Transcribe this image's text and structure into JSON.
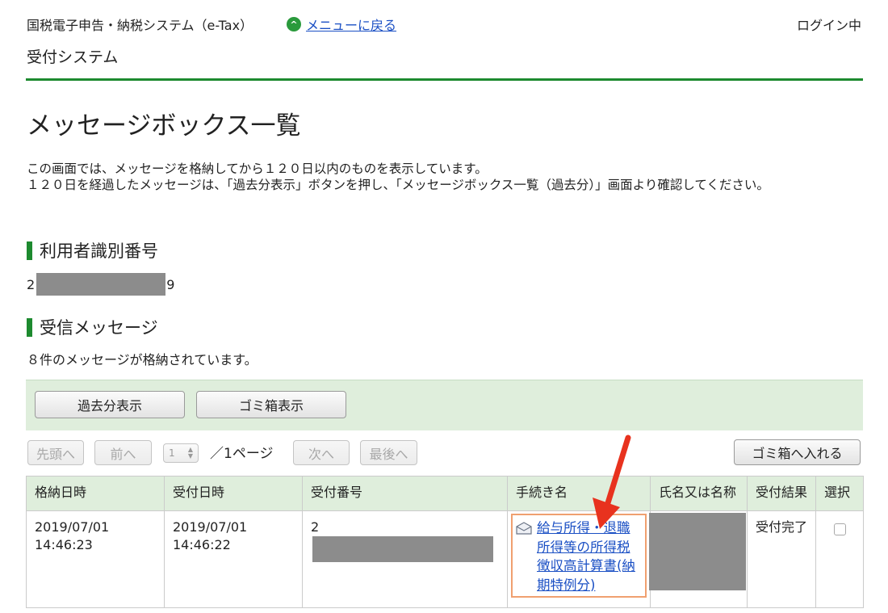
{
  "header": {
    "system_title": "国税電子申告・納税システム（e-Tax）",
    "menu_back_label": "メニューに戻る",
    "login_status": "ログイン中",
    "system_name": "受付システム"
  },
  "page": {
    "title": "メッセージボックス一覧",
    "intro_line1": "この画面では、メッセージを格納してから１２０日以内のものを表示しています。",
    "intro_line2": "１２０日を経過したメッセージは、「過去分表示」ボタンを押し、「メッセージボックス一覧（過去分）」画面より確認してください。"
  },
  "user_id_section": {
    "heading": "利用者識別番号",
    "value_prefix": "2",
    "value_suffix": "9"
  },
  "messages_section": {
    "heading": "受信メッセージ",
    "count_text": "８件のメッセージが格納されています。",
    "buttons": {
      "past": "過去分表示",
      "trash_view": "ゴミ箱表示",
      "first": "先頭へ",
      "prev": "前へ",
      "next": "次へ",
      "last": "最後へ",
      "to_trash": "ゴミ箱へ入れる"
    },
    "pagination": {
      "current_page": "1",
      "total_label": "／1ページ"
    },
    "table": {
      "headers": [
        "格納日時",
        "受付日時",
        "受付番号",
        "手続き名",
        "氏名又は名称",
        "受付結果",
        "選択"
      ],
      "rows": [
        {
          "stored_date": "2019/07/01",
          "stored_time": "14:46:23",
          "received_date": "2019/07/01",
          "received_time": "14:46:22",
          "receipt_no_prefix": "2",
          "procedure": "給与所得・退職所得等の所得税徴収高計算書(納期特例分)",
          "result": "受付完了"
        }
      ]
    }
  },
  "colors": {
    "accent_green": "#1d8a2f",
    "table_header_bg": "#dfeedc",
    "link_blue": "#1a4fc4",
    "highlight_orange": "#f0a070",
    "arrow_red": "#e8321e"
  }
}
